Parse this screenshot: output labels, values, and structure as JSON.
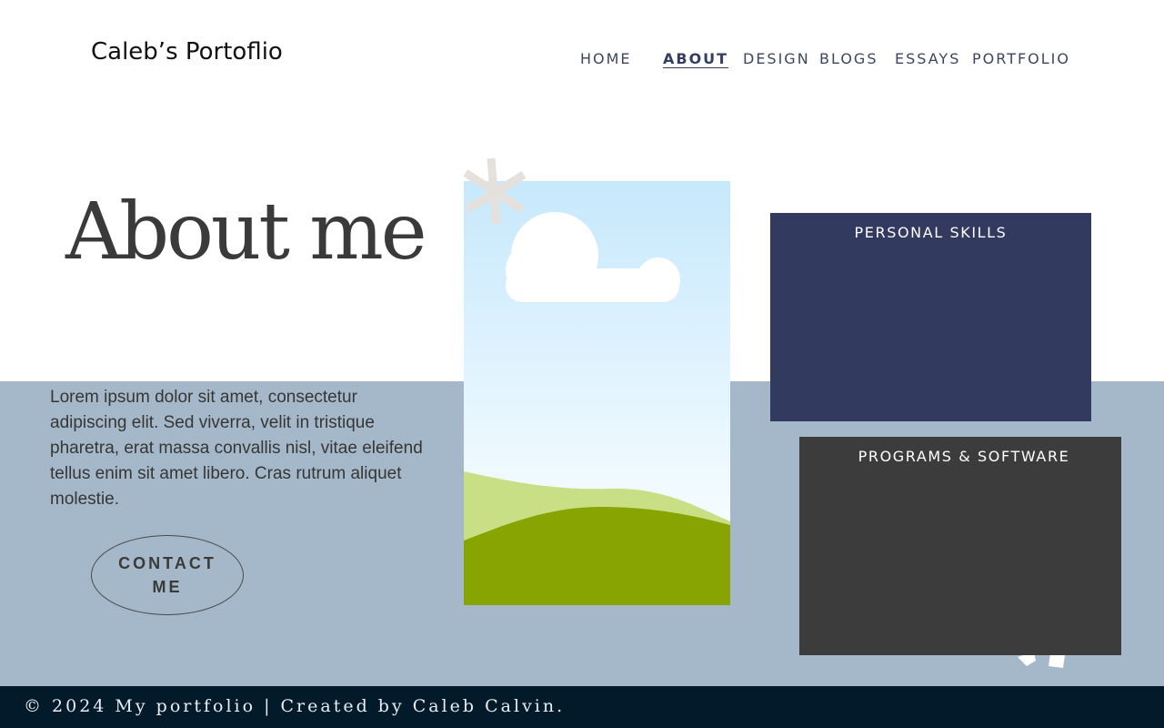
{
  "header": {
    "site_title": "Caleb’s Portoflio"
  },
  "nav": {
    "items": [
      {
        "label": "HOME",
        "active": false
      },
      {
        "label": "ABOUT",
        "active": true
      },
      {
        "label": "DESIGN",
        "active": false
      },
      {
        "label": "BLOGS",
        "active": false
      },
      {
        "label": "ESSAYS",
        "active": false
      },
      {
        "label": "PORTFOLIO",
        "active": false
      }
    ]
  },
  "hero": {
    "heading": "About me",
    "body": "Lorem ipsum dolor sit amet, consectetur adipiscing elit. Sed viverra, velit in tristique pharetra, erat massa convallis nisl, vitae eleifend tellus enim sit amet libero. Cras rutrum aliquet molestie.",
    "contact_label": "CONTACT ME"
  },
  "panels": {
    "skills_title": "PERSONAL SKILLS",
    "programs_title": "PROGRAMS & SOFTWARE"
  },
  "footer": {
    "text": "© 2024 My portfolio | Created by Caleb Calvin."
  },
  "icons": {
    "asterisk": "asterisk-icon",
    "cloud": "cloud-icon"
  },
  "colors": {
    "band": "#a5b8c9",
    "skills_panel": "#323a5f",
    "programs_panel": "#3c3c3c",
    "footer": "#031a2a",
    "sky_top": "#c7e8fc",
    "hill_light": "#c8df86",
    "hill_dark": "#88a402",
    "asterisk": "#e5e0dc"
  }
}
